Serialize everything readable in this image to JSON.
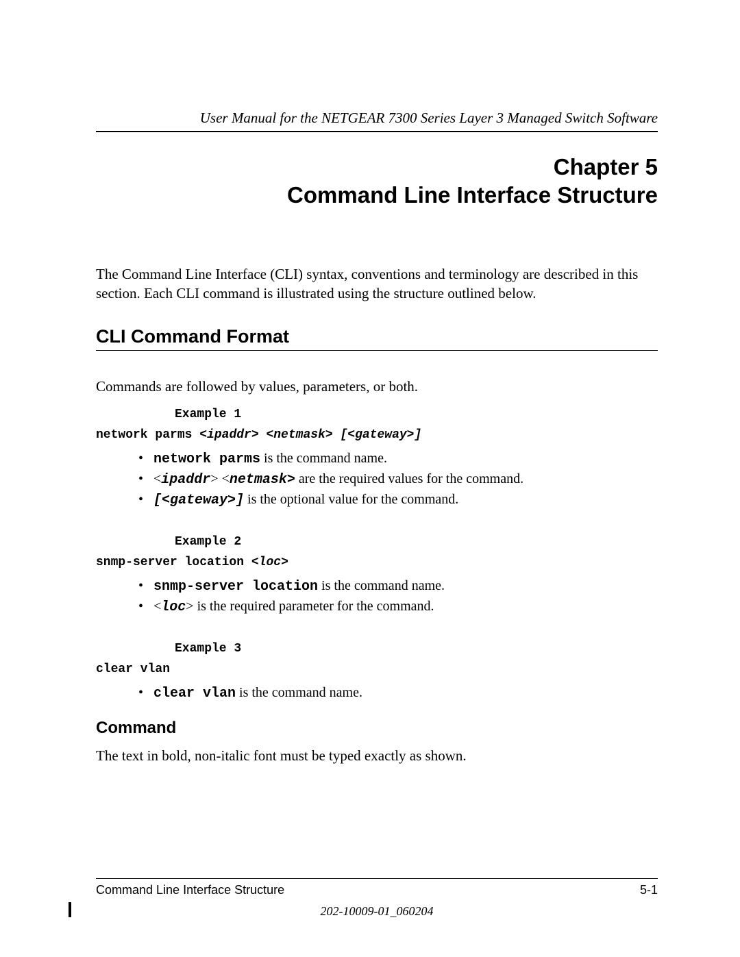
{
  "header": {
    "manual_title": "User Manual for the NETGEAR 7300 Series Layer 3 Managed Switch Software"
  },
  "chapter": {
    "label": "Chapter 5",
    "title": "Command Line Interface Structure"
  },
  "intro": "The Command Line Interface (CLI) syntax, conventions and terminology are described in this section. Each CLI command is illustrated using the structure outlined below.",
  "section1": {
    "heading": "CLI Command Format",
    "intro": "Commands are followed by values, parameters, or both."
  },
  "example1": {
    "label": "Example 1",
    "cmd_prefix": "network parms ",
    "cmd_args": "<ipaddr> <netmask> [<gateway>]",
    "b1_mono": "network parms",
    "b1_rest": " is the command name.",
    "b2_open1": "<",
    "b2_arg1": "ipaddr",
    "b2_close1": ">  <",
    "b2_arg2": "netmask>",
    "b2_rest": "  are the required values for the command.",
    "b3_mono": "[<gateway>]",
    "b3_rest": "  is the optional value for the command."
  },
  "example2": {
    "label": "Example 2",
    "cmd_prefix": "snmp-server location ",
    "cmd_open": "<",
    "cmd_arg": "loc",
    "cmd_close": ">",
    "b1_mono": "snmp-server location",
    "b1_rest": "  is the command name.",
    "b2_open": "<",
    "b2_arg": "loc",
    "b2_close": ">",
    "b2_rest": "  is the required parameter for the command."
  },
  "example3": {
    "label": "Example 3",
    "cmd": "clear vlan",
    "b1_mono": "clear vlan",
    "b1_rest": " is the command name."
  },
  "command_section": {
    "heading": "Command",
    "body": "The text in bold, non-italic font must be typed exactly as shown."
  },
  "footer": {
    "left": "Command Line Interface Structure",
    "right": "5-1",
    "docnum": "202-10009-01_060204"
  }
}
